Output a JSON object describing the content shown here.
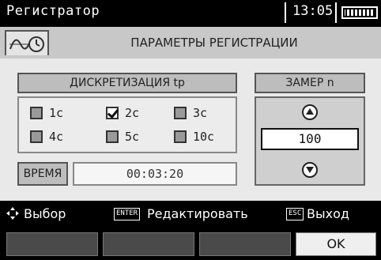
{
  "header": {
    "app_title": "Регистратор",
    "time": "13:05"
  },
  "titlebar": {
    "title": "ПАРАМЕТРЫ РЕГИСТРАЦИИ"
  },
  "sampling": {
    "heading": "ДИСКРЕТИЗАЦИЯ tр",
    "options": [
      {
        "label": "1с",
        "checked": false
      },
      {
        "label": "2с",
        "checked": true
      },
      {
        "label": "3с",
        "checked": false
      },
      {
        "label": "4с",
        "checked": false
      },
      {
        "label": "5с",
        "checked": false
      },
      {
        "label": "10с",
        "checked": false
      }
    ]
  },
  "duration": {
    "label": "ВРЕМЯ",
    "value": "00:03:20"
  },
  "measurement": {
    "heading": "ЗАМЕР n",
    "value": "100"
  },
  "hints": {
    "select": "Выбор",
    "enter_key": "ENTER",
    "edit": "Редактировать",
    "esc_key": "ESC",
    "exit": "Выход"
  },
  "softkeys": {
    "ok": "OK"
  }
}
